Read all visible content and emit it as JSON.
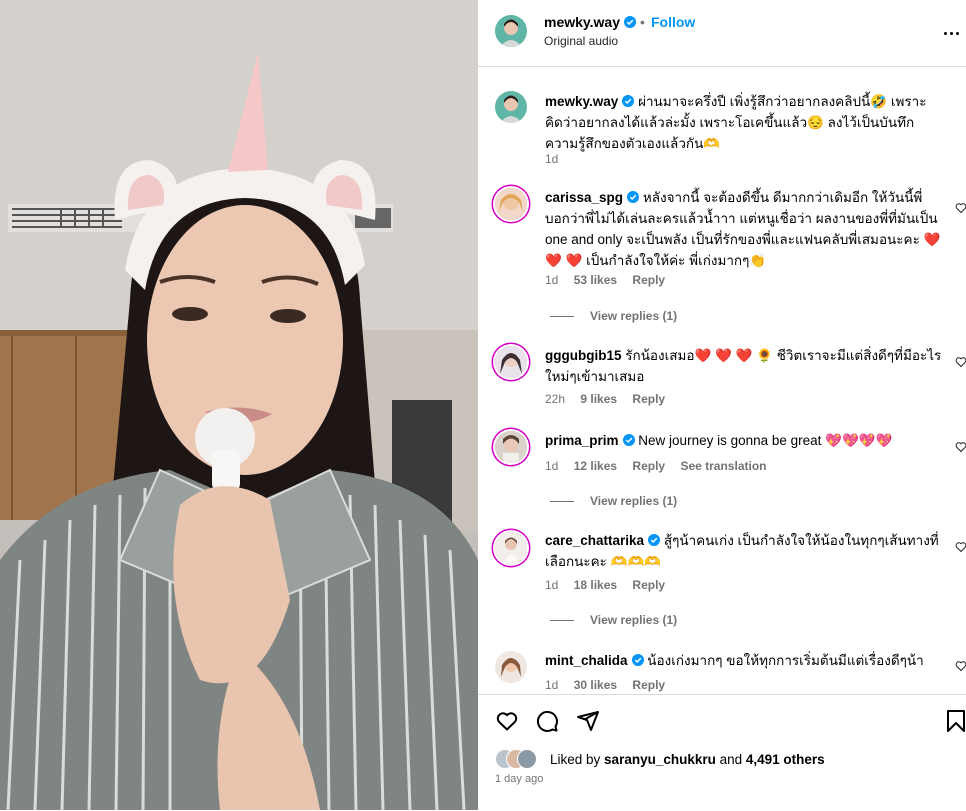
{
  "post": {
    "username": "mewky.way",
    "follow_label": "Follow",
    "dot": "•",
    "audio": "Original audio"
  },
  "caption": {
    "username": "mewky.way",
    "text": "ผ่านมาจะครึ่งปี เพิ่งรู้สึกว่าอยากลงคลิปนี้🤣 เพราะคิดว่าอยากลงได้แล้วล่ะมั้ง เพราะโอเคขึ้นแล้ว😔 ลงไว้เป็นบันทึกความรู้สึกของตัวเองแล้วกัน🫶",
    "time": "1d"
  },
  "comments": [
    {
      "username": "carissa_spg",
      "text": "หลังจากนี้ จะต้องดีขึ้น ดีมากกว่าเดิมอีก ให้วันนี้พี่บอกว่าพี่ไม่ได้เล่นละครแล้วน้ำาา แต่หนูเชื่อว่า ผลงานของพี่ที่มันเป็น one and only จะเป็นพลัง เป็นที่รักของพี่และแฟนคลับพี่เสมอนะคะ ❤️ ❤️ ❤️ เป็นกำลังใจให้ค่ะ พี่เก่งมากๆ👏",
      "time": "1d",
      "likes": "53 likes",
      "reply": "Reply",
      "view_replies": "View replies (1)"
    },
    {
      "username": "gggubgib15",
      "text": "รักน้องเสมอ❤️ ❤️ ❤️ 🌻 ชีวิตเราจะมีแต่สิ่งดีๆที่มีอะไรใหม่ๆเข้ามาเสมอ",
      "time": "22h",
      "likes": "9 likes",
      "reply": "Reply"
    },
    {
      "username": "prima_prim",
      "text": "New journey is gonna be great 💖💖💖💖",
      "time": "1d",
      "likes": "12 likes",
      "reply": "Reply",
      "see_translation": "See translation",
      "view_replies": "View replies (1)"
    },
    {
      "username": "care_chattarika",
      "text": "สู้ๆน้าคนเก่ง เป็นกำลังใจให้น้องในทุกๆเส้นทางที่เลือกนะคะ 🫶🫶🫶",
      "time": "1d",
      "likes": "18 likes",
      "reply": "Reply",
      "view_replies": "View replies (1)"
    },
    {
      "username": "mint_chalida",
      "text": "น้องเก่งมากๆ ขอให้ทุกการเริ่มต้นมีแต่เรื่องดีๆน้า",
      "time": "1d",
      "likes": "30 likes",
      "reply": "Reply"
    }
  ],
  "likes_summary": {
    "prefix": "Liked by ",
    "user": "saranyu_chukkru",
    "mid": " and ",
    "others": "4,491 others"
  },
  "posted_ago": "1 day ago",
  "colors": {
    "link_blue": "#0095f6",
    "verified_blue": "#0095f6",
    "muted": "#737373",
    "story_ring": "#d300c5"
  }
}
